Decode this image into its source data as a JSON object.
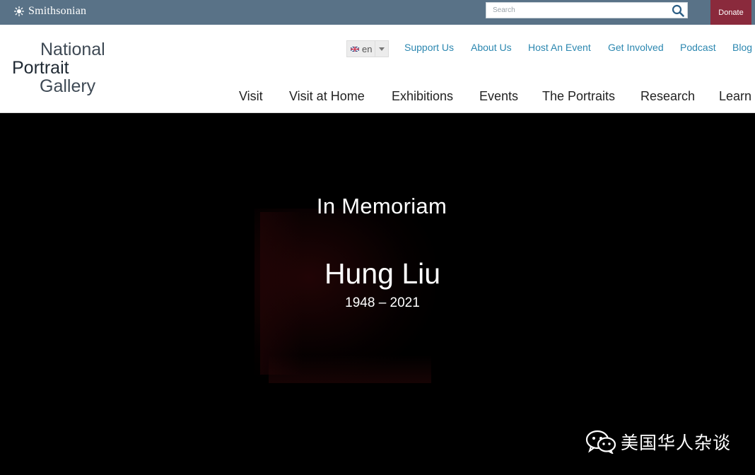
{
  "topbar": {
    "brand": "Smithsonian",
    "search_placeholder": "Search",
    "donate_label": "Donate"
  },
  "header": {
    "logo_lines": [
      "National",
      "Portrait",
      "Gallery"
    ],
    "language": {
      "code": "en"
    },
    "utility_links": [
      "Support Us",
      "About Us",
      "Host An Event",
      "Get Involved",
      "Podcast",
      "Blog"
    ],
    "main_nav": [
      "Visit",
      "Visit at Home",
      "Exhibitions",
      "Events",
      "The Portraits",
      "Research",
      "Learn"
    ]
  },
  "hero": {
    "heading": "In Memoriam",
    "name": "Hung Liu",
    "years": "1948 – 2021"
  },
  "watermark": {
    "text": "美国华人杂谈",
    "icon": "wechat-icon"
  },
  "colors": {
    "topbar": "#597287",
    "donate": "#8a2a3c",
    "link": "#2b87b0",
    "hero_bg": "#000000"
  }
}
